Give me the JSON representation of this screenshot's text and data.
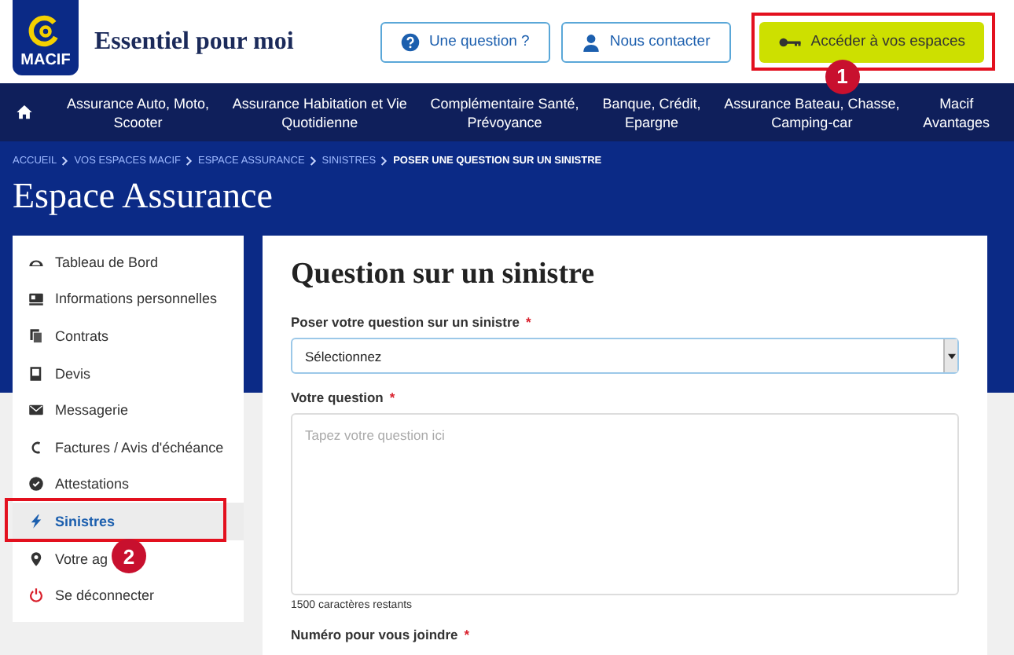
{
  "header": {
    "logo": "MACIF",
    "title": "Essentiel pour moi",
    "buttons": [
      {
        "label": "Une question ?",
        "kind": "question"
      },
      {
        "label": "Nous contacter",
        "kind": "contact"
      },
      {
        "label": "Accéder à vos espaces",
        "kind": "access",
        "callout": "1"
      }
    ]
  },
  "nav": [
    {
      "label": "Assurance Auto, Moto,\nScooter"
    },
    {
      "label": "Assurance Habitation et Vie\nQuotidienne"
    },
    {
      "label": "Complémentaire Santé,\nPrévoyance"
    },
    {
      "label": "Banque, Crédit,\nEpargne"
    },
    {
      "label": "Assurance Bateau, Chasse,\nCamping-car"
    },
    {
      "label": "Macif\nAvantages"
    }
  ],
  "breadcrumb": [
    {
      "label": "ACCUEIL",
      "current": false
    },
    {
      "label": "VOS ESPACES MACIF",
      "current": false
    },
    {
      "label": "ESPACE ASSURANCE",
      "current": false
    },
    {
      "label": "SINISTRES",
      "current": false
    },
    {
      "label": "POSER UNE QUESTION SUR UN SINISTRE",
      "current": true
    }
  ],
  "page_title": "Espace Assurance",
  "sidebar": {
    "items": [
      {
        "label": "Tableau de Bord",
        "selected": false
      },
      {
        "label": "Informations personnelles",
        "selected": false
      },
      {
        "label": "Contrats",
        "selected": false
      },
      {
        "label": "Devis",
        "selected": false
      },
      {
        "label": "Messagerie",
        "selected": false
      },
      {
        "label": "Factures / Avis d'échéance",
        "selected": false
      },
      {
        "label": "Attestations",
        "selected": false
      },
      {
        "label": "Sinistres",
        "selected": true,
        "callout": "2"
      },
      {
        "label": "Votre ag",
        "selected": false
      },
      {
        "label": "Se déconnecter",
        "selected": false
      }
    ]
  },
  "form": {
    "title": "Question sur un sinistre",
    "fields": [
      {
        "kind": "select",
        "label": "Poser votre question sur un sinistre",
        "mark": "*",
        "value": "Sélectionnez"
      },
      {
        "kind": "textarea",
        "label": "Votre question",
        "mark": "*",
        "placeholder": "Tapez votre question ici",
        "counter": "1500 caractères restants"
      },
      {
        "kind": "label",
        "label": "Numéro pour vous joindre",
        "mark": "*"
      }
    ]
  }
}
